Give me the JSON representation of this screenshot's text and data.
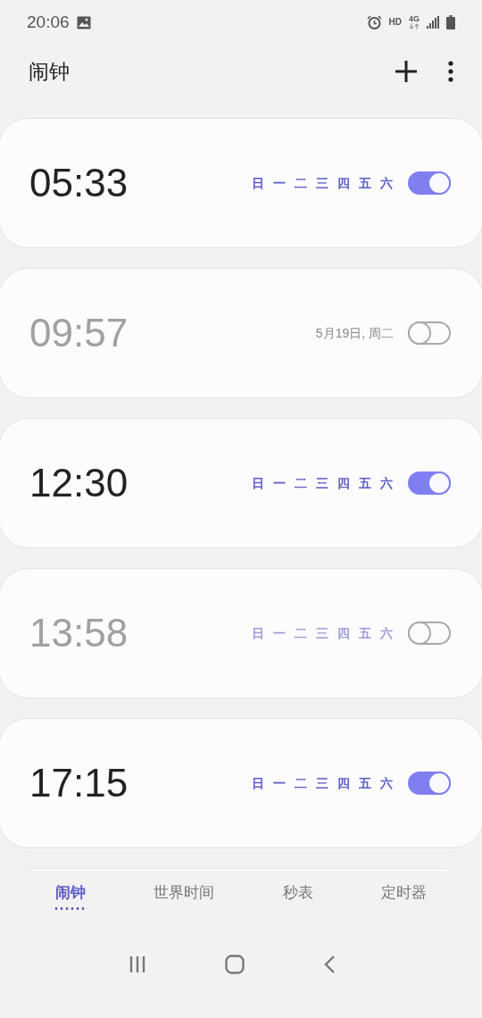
{
  "status_bar": {
    "time": "20:06",
    "network": "HD",
    "network_type": "4G"
  },
  "header": {
    "title": "闹钟"
  },
  "alarms": [
    {
      "time": "05:33",
      "on": true,
      "kind": "days",
      "days": [
        "日",
        "一",
        "二",
        "三",
        "四",
        "五",
        "六"
      ]
    },
    {
      "time": "09:57",
      "on": false,
      "kind": "date",
      "date": "5月19日, 周二"
    },
    {
      "time": "12:30",
      "on": true,
      "kind": "days",
      "days": [
        "日",
        "一",
        "二",
        "三",
        "四",
        "五",
        "六"
      ]
    },
    {
      "time": "13:58",
      "on": false,
      "kind": "days",
      "days": [
        "日",
        "一",
        "二",
        "三",
        "四",
        "五",
        "六"
      ]
    },
    {
      "time": "17:15",
      "on": true,
      "kind": "days",
      "days": [
        "日",
        "一",
        "二",
        "三",
        "四",
        "五",
        "六"
      ]
    }
  ],
  "tabs": [
    {
      "label": "闹钟",
      "selected": true
    },
    {
      "label": "世界时间",
      "selected": false
    },
    {
      "label": "秒表",
      "selected": false
    },
    {
      "label": "定时器",
      "selected": false
    }
  ]
}
